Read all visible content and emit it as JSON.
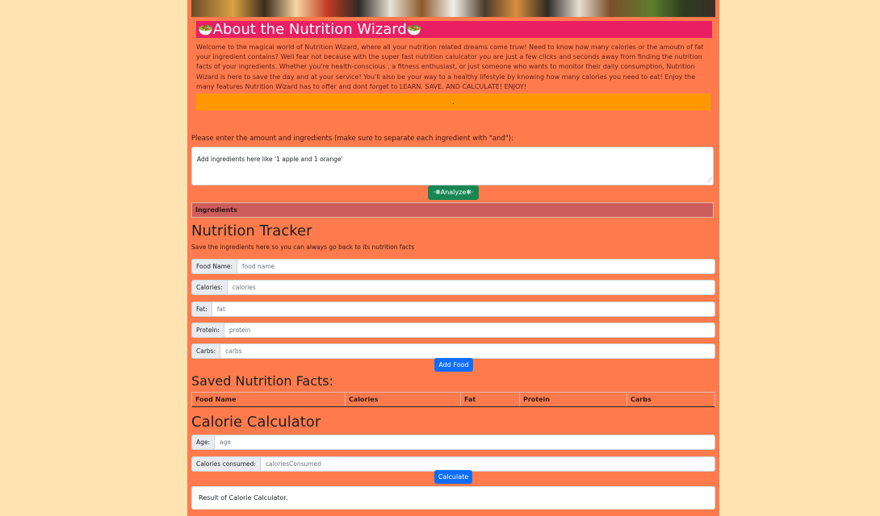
{
  "about": {
    "title": "About the Nutrition Wizard",
    "title_emoji": "🥗",
    "text": "Welcome to the magical world of Nutrition Wizard, where all your nutrition related dreams come truw! Need to know how many calories or the amoutn of fat your ingredient contains? Well fear not because with the super fast nutrition calulcator you are just a few clicks and seconds away from finding the nutrition facts of your ingredients. Whether you're health-conscious , a fitness enthusiast, or just someone who wants to monitor their daily consumption, Nutrition Wizard is here to save the day and at your service! You'll also be  your way to a healthy lifestyle by knowing how many calories you need to eat! Enjoy the many features Nutrition Wizard has to offer and dont forget to LEARN. SAVE. AND CALCULATE! ENJOY!",
    "bar_text": "."
  },
  "analyzer": {
    "prompt": "Please enter the amount and ingredients (make sure to separate each ingredient with \"and\"):",
    "placeholder": "Add ingredients here like '1 apple and 1 orange'",
    "button": "·❋Analyze❋·",
    "ingredients_header": "Ingredients"
  },
  "tracker": {
    "title": "Nutrition Tracker",
    "subtitle": "Save the ingredients here so you can always go back to its nutrition facts",
    "fields": [
      {
        "label": "Food Name:",
        "placeholder": "food name"
      },
      {
        "label": "Calories:",
        "placeholder": "calories"
      },
      {
        "label": "Fat:",
        "placeholder": "fat"
      },
      {
        "label": "Protein:",
        "placeholder": "protein"
      },
      {
        "label": "Carbs:",
        "placeholder": "carbs"
      }
    ],
    "add_button": "Add Food"
  },
  "saved": {
    "title": "Saved Nutrition Facts:",
    "columns": [
      "Food Name",
      "Calories",
      "Fat",
      "Protein",
      "Carbs"
    ]
  },
  "calculator": {
    "title": "Calorie Calculator",
    "fields": [
      {
        "label": "Age:",
        "placeholder": "age"
      },
      {
        "label": "Calories consumed:",
        "placeholder": "caloriesConsumed"
      }
    ],
    "button": "Calculate",
    "result": "Result of Calorie Calculator."
  },
  "colors": {
    "page_bg": "#ffe4b1",
    "content_bg": "#ff7b4d",
    "title_bar": "#e91e63",
    "orange_bar": "#ff9800",
    "analyze_button": "#198754",
    "ingredients_header": "#cd5c5c",
    "primary_button": "#0d6efd"
  }
}
